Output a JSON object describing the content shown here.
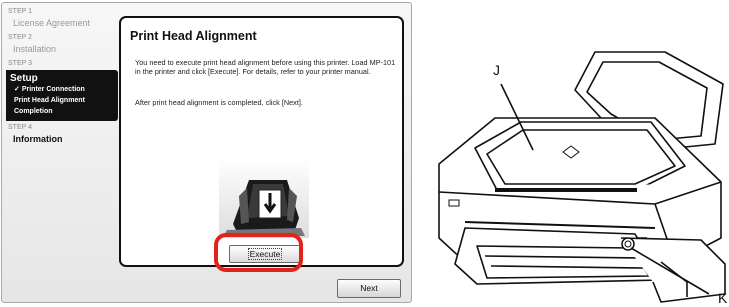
{
  "sidebar": {
    "steps": [
      {
        "label": "STEP 1",
        "title": "License Agreement"
      },
      {
        "label": "STEP 2",
        "title": "Installation"
      },
      {
        "label": "STEP 3",
        "title": "Setup",
        "subitems": [
          "Printer Connection",
          "Print Head Alignment",
          "Completion"
        ],
        "checked_subitem": "✓"
      },
      {
        "label": "STEP 4",
        "title": "Information"
      }
    ]
  },
  "dialog": {
    "title": "Print Head Alignment",
    "paragraph1": "You need to execute print head alignment before using this printer. Load MP-101 in the printer and click [Execute]. For details, refer to your printer manual.",
    "paragraph2": "After print head alignment is completed, click [Next].",
    "execute_label": "Execute",
    "next_label": "Next"
  },
  "printer": {
    "callout_j": "J",
    "callout_k": "K"
  },
  "colors": {
    "highlight": "#e2231a",
    "sidebar_active": "#111111"
  },
  "icons": {
    "illustration": "paper-loading-arrow-icon",
    "printer": "printer-illustration"
  }
}
